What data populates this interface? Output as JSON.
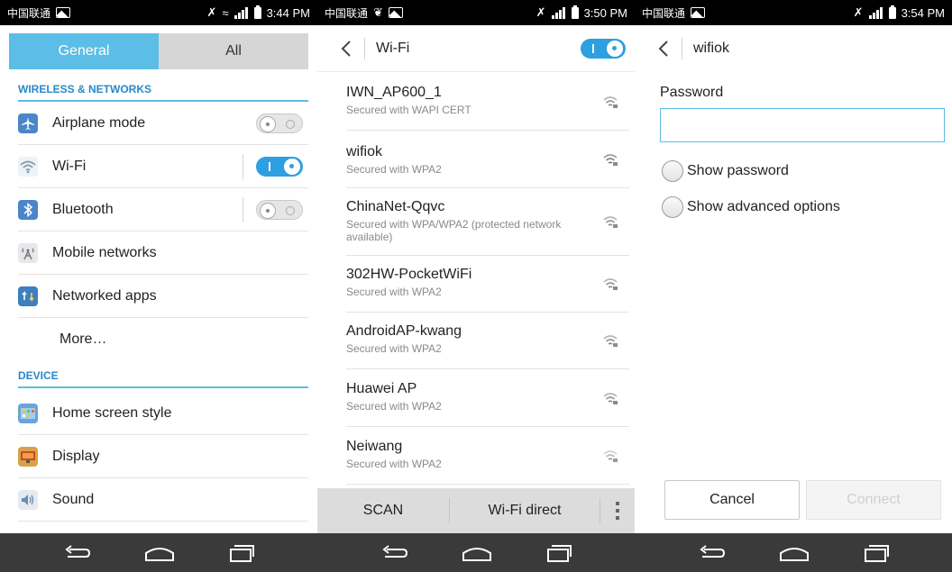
{
  "status_bars": [
    {
      "carrier": "中国联通",
      "time": "3:44 PM"
    },
    {
      "carrier": "中国联通",
      "time": "3:50 PM"
    },
    {
      "carrier": "中国联通",
      "time": "3:54 PM"
    }
  ],
  "settings": {
    "tabs": [
      "General",
      "All"
    ],
    "sections": {
      "wireless": "WIRELESS & NETWORKS",
      "device": "DEVICE"
    },
    "items": [
      {
        "label": "Airplane mode",
        "icon": "airplane-icon",
        "toggle": "off"
      },
      {
        "label": "Wi-Fi",
        "icon": "wifi-icon",
        "toggle": "on"
      },
      {
        "label": "Bluetooth",
        "icon": "bluetooth-icon",
        "toggle": "off"
      },
      {
        "label": "Mobile networks",
        "icon": "mobile-network-icon"
      },
      {
        "label": "Networked apps",
        "icon": "networked-apps-icon"
      },
      {
        "label": "More…"
      },
      {
        "label": "Home screen style",
        "icon": "home-screen-icon"
      },
      {
        "label": "Display",
        "icon": "display-icon"
      },
      {
        "label": "Sound",
        "icon": "sound-icon"
      }
    ]
  },
  "wifi": {
    "title": "Wi-Fi",
    "master_toggle": "on",
    "networks": [
      {
        "name": "IWN_AP600_1",
        "security": "Secured with WAPI CERT"
      },
      {
        "name": "wifiok",
        "security": "Secured with WPA2"
      },
      {
        "name": "ChinaNet-Qqvc",
        "security": "Secured with WPA/WPA2 (protected network available)"
      },
      {
        "name": "302HW-PocketWiFi",
        "security": "Secured with WPA2"
      },
      {
        "name": "AndroidAP-kwang",
        "security": "Secured with WPA2"
      },
      {
        "name": "Huawei AP",
        "security": "Secured with WPA2"
      },
      {
        "name": "Neiwang",
        "security": "Secured with WPA2"
      }
    ],
    "actions": {
      "scan": "SCAN",
      "direct": "Wi-Fi direct"
    }
  },
  "dialog": {
    "title": "wifiok",
    "password_label": "Password",
    "password_value": "",
    "show_password": "Show password",
    "show_advanced": "Show advanced options",
    "cancel": "Cancel",
    "connect": "Connect"
  },
  "colors": {
    "accent": "#5cbde6",
    "toggle_on": "#2e9fe0",
    "section_text": "#2a88c8"
  }
}
